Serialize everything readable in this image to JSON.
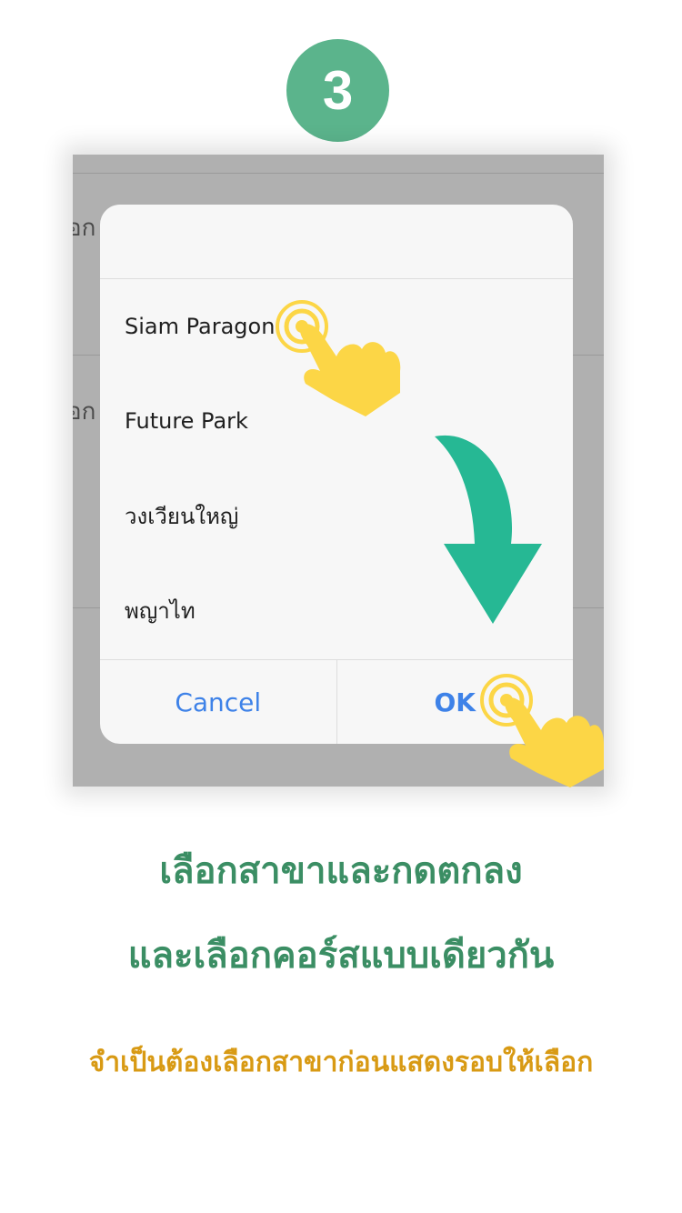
{
  "step": {
    "number": "3"
  },
  "background_fragments": [
    "อก",
    "อก"
  ],
  "dialog": {
    "options": [
      "Siam Paragon",
      "Future Park",
      "วงเวียนใหญ่",
      "พญาไท"
    ],
    "cancel_label": "Cancel",
    "ok_label": "OK"
  },
  "caption": {
    "line1": "เลือกสาขาและกดตกลง",
    "line2": "และเลือกคอร์สแบบเดียวกัน"
  },
  "note": "จำเป็นต้องเลือกสาขาก่อนแสดงรอบให้เลือก",
  "colors": {
    "badge": "#5bb48c",
    "arrow": "#26b894",
    "caption": "#3b8e64",
    "note": "#d89a14",
    "button_text": "#3e82e8",
    "hand": "#fcd646"
  },
  "icons": [
    "tap-hand-icon",
    "down-arrow-icon"
  ]
}
